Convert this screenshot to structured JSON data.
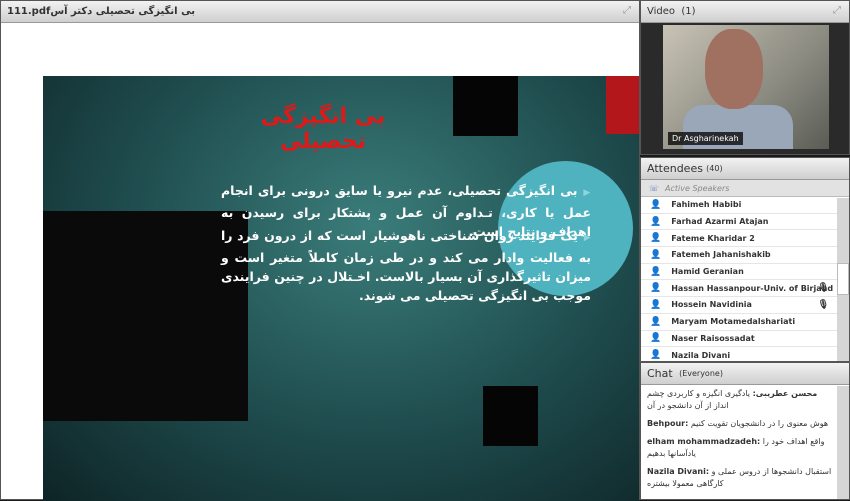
{
  "share": {
    "title": "111.pdfبی انگیزگی تحصیلی دکتر آس",
    "maximize_icon": "expand-icon"
  },
  "slide": {
    "title": "بی انگیزگی تحصیلی",
    "bullets": [
      "بی انگیزگی تحصیلی، عدم نیرو یا سایق درونی برای انجام عمل یا کاری، تـداوم آن عمل و پشتکار برای رسیدن به اهداف و نتایج است.",
      "یک فرایند روان شناختی ناهوشیار است که از درون فرد را به فعالیت وادار می کند و در طی زمان کاملاً متغیر است و میزان تاثیرگذاری آن بسیار بالاست. اخـتلال در چنین فرایندی موجب بی انگیزگی تحصیلی می شوند."
    ],
    "colors": {
      "title": "#e01818",
      "accent": "#b3161b",
      "circle": "#4fb3bf"
    }
  },
  "video": {
    "title": "Video",
    "count": "(1)",
    "camera_label": "Dr Asgharinekah"
  },
  "attendees": {
    "title": "Attendees",
    "count": "(40)",
    "active_speakers": "Active Speakers",
    "list": [
      {
        "name": "Fahimeh Habibi",
        "mic": ""
      },
      {
        "name": "Farhad Azarmi Atajan",
        "mic": ""
      },
      {
        "name": "Fateme Kharidar 2",
        "mic": ""
      },
      {
        "name": "Fatemeh Jahanishakib",
        "mic": ""
      },
      {
        "name": "Hamid Geranian",
        "mic": ""
      },
      {
        "name": "Hassan Hassanpour-Univ. of Birjand",
        "mic": "🎙"
      },
      {
        "name": "Hossein Navidinia",
        "mic": "🎙"
      },
      {
        "name": "Maryam Motamedalshariati",
        "mic": ""
      },
      {
        "name": "Naser Raisossadat",
        "mic": ""
      },
      {
        "name": "Nazila Divani",
        "mic": ""
      }
    ]
  },
  "chat": {
    "title": "Chat",
    "scope": "(Everyone)",
    "messages": [
      {
        "sender": "محسن عطریبی:",
        "text": "یادگیری انگیزه و کاربردی چشم انداز از آن دانشجو در آن"
      },
      {
        "sender": "Behpour:",
        "text": "هوش معنوی را در دانشجویان تقویت کنیم"
      },
      {
        "sender": "elham mohammadzadeh:",
        "text": "واقع اهداف خود را یادآسانها بدهیم"
      },
      {
        "sender": "Nazila Divani:",
        "text": "استقبال دانشجوها از دروس عملی و کارگاهی معمولا بیشتره"
      }
    ]
  }
}
